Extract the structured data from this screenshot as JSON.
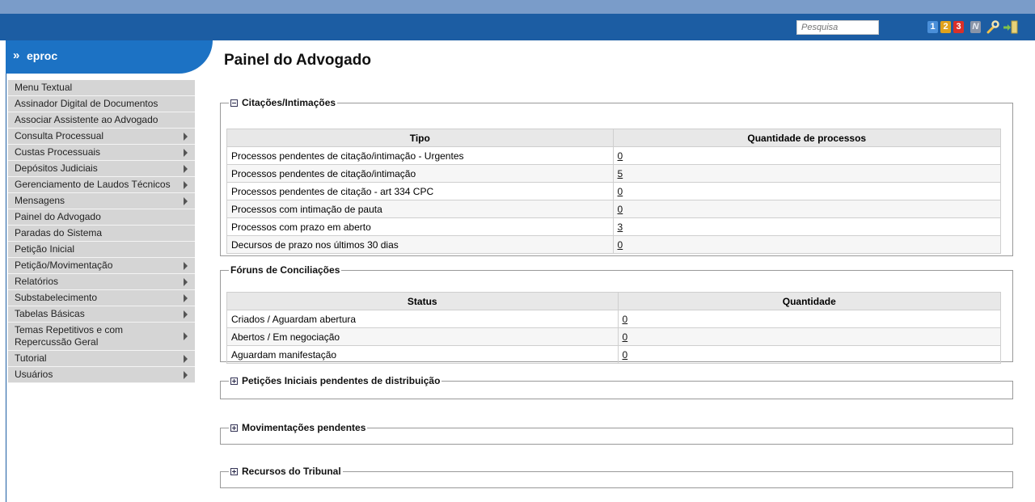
{
  "header": {
    "search_placeholder": "Pesquisa",
    "badges": [
      "1",
      "2",
      "3",
      "N"
    ],
    "tools_icon": "wrench-icon",
    "exit_icon": "logout-icon"
  },
  "sidebar": {
    "title": "eproc",
    "collapse_icon": "double-chevron-up-icon",
    "items": [
      {
        "label": "Menu Textual",
        "submenu": false
      },
      {
        "label": "Assinador Digital de Documentos",
        "submenu": false
      },
      {
        "label": "Associar Assistente ao Advogado",
        "submenu": false
      },
      {
        "label": "Consulta Processual",
        "submenu": true
      },
      {
        "label": "Custas Processuais",
        "submenu": true
      },
      {
        "label": "Depósitos Judiciais",
        "submenu": true
      },
      {
        "label": "Gerenciamento de Laudos Técnicos",
        "submenu": true
      },
      {
        "label": "Mensagens",
        "submenu": true
      },
      {
        "label": "Painel do Advogado",
        "submenu": false
      },
      {
        "label": "Paradas do Sistema",
        "submenu": false
      },
      {
        "label": "Petição Inicial",
        "submenu": false
      },
      {
        "label": "Petição/Movimentação",
        "submenu": true
      },
      {
        "label": "Relatórios",
        "submenu": true
      },
      {
        "label": "Substabelecimento",
        "submenu": true
      },
      {
        "label": "Tabelas Básicas",
        "submenu": true
      },
      {
        "label": "Temas Repetitivos e com Repercussão Geral",
        "submenu": true
      },
      {
        "label": "Tutorial",
        "submenu": true
      },
      {
        "label": "Usuários",
        "submenu": true
      }
    ]
  },
  "main": {
    "title": "Painel do Advogado",
    "citacoes": {
      "legend": "Citações/Intimações",
      "expanded": true,
      "headers": [
        "Tipo",
        "Quantidade de processos"
      ],
      "rows": [
        {
          "tipo": "Processos pendentes de citação/intimação - Urgentes",
          "qtd": "0"
        },
        {
          "tipo": "Processos pendentes de citação/intimação",
          "qtd": "5"
        },
        {
          "tipo": "Processos pendentes de citação - art 334 CPC",
          "qtd": "0"
        },
        {
          "tipo": "Processos com intimação de pauta",
          "qtd": "0"
        },
        {
          "tipo": "Processos com prazo em aberto",
          "qtd": "3"
        },
        {
          "tipo": "Decursos de prazo nos últimos 30 dias",
          "qtd": "0"
        }
      ]
    },
    "foruns": {
      "legend": "Fóruns de Conciliações",
      "headers": [
        "Status",
        "Quantidade"
      ],
      "rows": [
        {
          "status": "Criados / Aguardam abertura",
          "qtd": "0"
        },
        {
          "status": "Abertos / Em negociação",
          "qtd": "0"
        },
        {
          "status": "Aguardam manifestação",
          "qtd": "0"
        }
      ]
    },
    "peticoes": {
      "legend": "Petições Iniciais pendentes de distribuição",
      "expanded": false
    },
    "movimentacoes": {
      "legend": "Movimentações pendentes",
      "expanded": false
    },
    "recursos": {
      "legend": "Recursos do Tribunal",
      "expanded": false
    }
  },
  "colors": {
    "topbar": "#1c5da3",
    "topstrip": "#7a9cc9",
    "sidebar_tab": "#1c72c4",
    "menu_item_bg": "#d5d5d5",
    "table_header_bg": "#e8e8e8"
  }
}
